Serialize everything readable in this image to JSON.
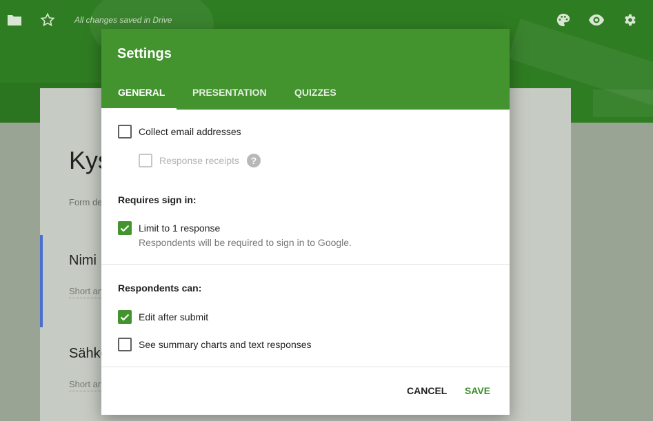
{
  "app_bar": {
    "status_text": "All changes saved in Drive",
    "icons": [
      "folder-icon",
      "star-icon",
      "palette-icon",
      "eye-icon",
      "gear-icon"
    ]
  },
  "form": {
    "title_visible": "Kys",
    "description_visible": "Form de",
    "questions": [
      {
        "title_visible": "Nimi",
        "hint_visible": "Short an"
      },
      {
        "title_visible": "Sähkö",
        "hint_visible": "Short an"
      }
    ]
  },
  "dialog": {
    "title": "Settings",
    "tabs": [
      {
        "label": "GENERAL",
        "active": true
      },
      {
        "label": "PRESENTATION",
        "active": false
      },
      {
        "label": "QUIZZES",
        "active": false
      }
    ],
    "collect_email": {
      "label": "Collect email addresses",
      "checked": false
    },
    "response_receipts": {
      "label": "Response receipts",
      "checked": false,
      "disabled": true
    },
    "requires_sign_in": {
      "heading": "Requires sign in:",
      "limit_one": {
        "label": "Limit to 1 response",
        "checked": true,
        "description": "Respondents will be required to sign in to Google."
      }
    },
    "respondents_can": {
      "heading": "Respondents can:",
      "edit_after_submit": {
        "label": "Edit after submit",
        "checked": true
      },
      "see_summary": {
        "label": "See summary charts and text responses",
        "checked": false
      }
    },
    "buttons": {
      "cancel": "CANCEL",
      "save": "SAVE"
    }
  },
  "colors": {
    "header_green": "#43942f",
    "accent_green": "#3a8f2a",
    "topbar_green": "#2f7d22"
  }
}
